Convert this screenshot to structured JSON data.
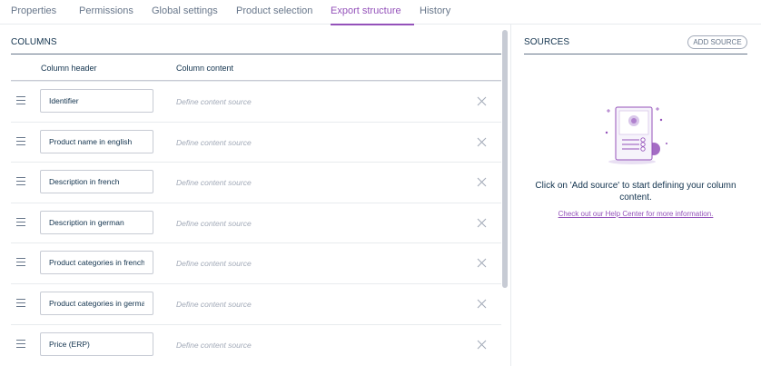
{
  "tabs": [
    "Properties",
    "Permissions",
    "Global settings",
    "Product selection",
    "Export structure",
    "History"
  ],
  "active_tab": "Export structure",
  "columns": {
    "title": "Columns",
    "header_label": "Column header",
    "content_label": "Column content",
    "rows": [
      {
        "header": "Identifier",
        "content_placeholder": "Define content source"
      },
      {
        "header": "Product name in english",
        "content_placeholder": "Define content source"
      },
      {
        "header": "Description in french",
        "content_placeholder": "Define content source"
      },
      {
        "header": "Description in german",
        "content_placeholder": "Define content source"
      },
      {
        "header": "Product categories in french",
        "content_placeholder": "Define content source"
      },
      {
        "header": "Product categories in german",
        "content_placeholder": "Define content source"
      },
      {
        "header": "Price (ERP)",
        "content_placeholder": "Define content source"
      }
    ]
  },
  "sources": {
    "title": "Sources",
    "add_button": "Add source",
    "empty_message": "Click on 'Add source' to start defining your column content.",
    "help_link": "Check out our Help Center for more information.",
    "illustration_icon": "document-settings-illustration"
  },
  "icons": {
    "drag": "drag-handle-icon",
    "remove": "close-icon"
  },
  "colors": {
    "accent": "#9452ba",
    "text": "#11324d",
    "muted": "#67768a",
    "placeholder": "#a1a9b7",
    "border": "#c7cbd4"
  }
}
